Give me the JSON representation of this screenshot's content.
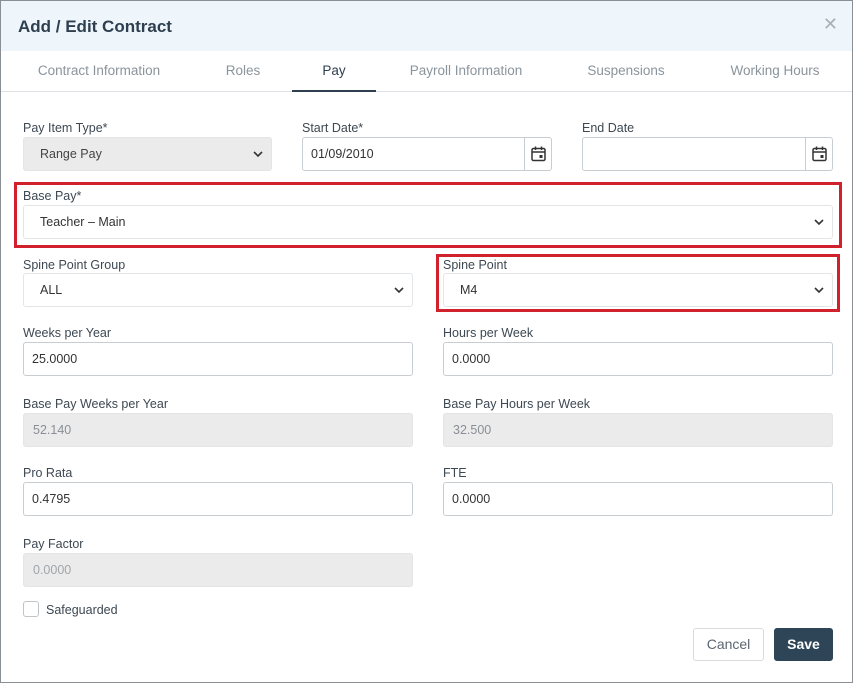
{
  "dialog": {
    "title": "Add / Edit Contract"
  },
  "tabs": [
    {
      "label": "Contract Information"
    },
    {
      "label": "Roles"
    },
    {
      "label": "Pay"
    },
    {
      "label": "Payroll Information"
    },
    {
      "label": "Suspensions"
    },
    {
      "label": "Working Hours"
    }
  ],
  "active_tab": "Pay",
  "form": {
    "pay_item_type": {
      "label": "Pay Item Type*",
      "value": "Range Pay"
    },
    "start_date": {
      "label": "Start Date*",
      "value": "01/09/2010"
    },
    "end_date": {
      "label": "End Date",
      "value": ""
    },
    "base_pay": {
      "label": "Base Pay*",
      "value": "Teacher – Main"
    },
    "spine_point_group": {
      "label": "Spine Point Group",
      "value": "ALL"
    },
    "spine_point": {
      "label": "Spine Point",
      "value": "M4"
    },
    "weeks_per_year": {
      "label": "Weeks per Year",
      "value": "25.0000"
    },
    "hours_per_week": {
      "label": "Hours per Week",
      "value": "0.0000"
    },
    "base_pay_weeks_per_year": {
      "label": "Base Pay Weeks per Year",
      "value": "52.140"
    },
    "base_pay_hours_per_week": {
      "label": "Base Pay Hours per Week",
      "value": "32.500"
    },
    "pro_rata": {
      "label": "Pro Rata",
      "value": "0.4795"
    },
    "fte": {
      "label": "FTE",
      "value": "0.0000"
    },
    "pay_factor": {
      "label": "Pay Factor",
      "placeholder": "0.0000"
    },
    "safeguarded": {
      "label": "Safeguarded",
      "checked": false
    }
  },
  "buttons": {
    "cancel": "Cancel",
    "save": "Save"
  },
  "colors": {
    "highlight": "#d0212c",
    "primary": "#2e4557",
    "header_bg": "#eef5fb"
  },
  "icons": {
    "close": "close-icon",
    "calendar": "calendar-icon",
    "chevron": "chevron-down-icon"
  }
}
